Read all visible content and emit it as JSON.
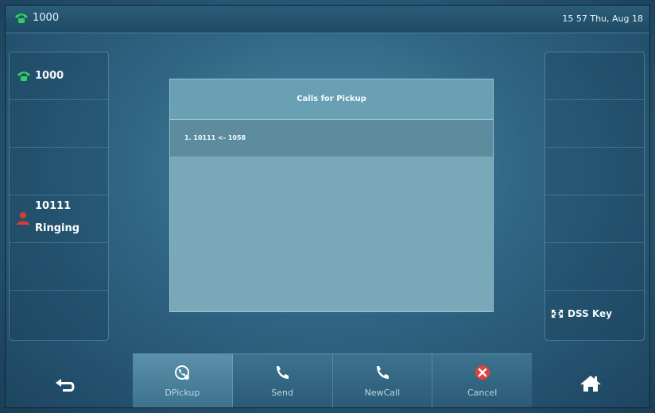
{
  "status_bar": {
    "line_label": "1000",
    "datetime": "15 57 Thu, Aug 18"
  },
  "left_panel": {
    "line_key": "1000",
    "ringing_number": "10111",
    "ringing_state": "Ringing"
  },
  "right_panel": {
    "dss_label": "DSS Key"
  },
  "dialog": {
    "title": "Calls for Pickup",
    "items": [
      "1. 10111 <- 1058"
    ]
  },
  "softkeys": [
    {
      "label": "DPickup",
      "icon": "dpickup-icon"
    },
    {
      "label": "Send",
      "icon": "phone-icon"
    },
    {
      "label": "NewCall",
      "icon": "phone-icon"
    },
    {
      "label": "Cancel",
      "icon": "cancel-icon"
    }
  ],
  "colors": {
    "line_green": "#2fcf62",
    "cancel_red": "#e0443a",
    "ringing_red": "#d93b36"
  }
}
